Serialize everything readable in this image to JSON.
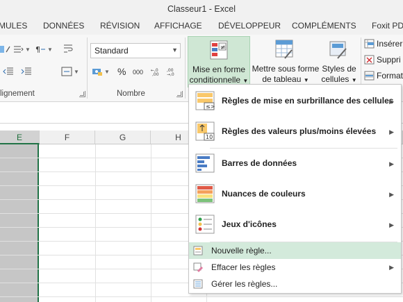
{
  "window": {
    "title": "Classeur1 - Excel"
  },
  "tabs": [
    "MULES",
    "DONNÉES",
    "RÉVISION",
    "AFFICHAGE",
    "DÉVELOPPEUR",
    "COMPLÉMENTS",
    "Foxit PDF"
  ],
  "ribbon": {
    "alignment_label": "lignement",
    "number_label": "Nombre",
    "number_format_value": "Standard",
    "percent_symbol": "%",
    "thousands_symbol": "000",
    "cond_format_line1": "Mise en forme",
    "cond_format_line2": "conditionnelle",
    "table_format_line1": "Mettre sous forme",
    "table_format_line2": "de tableau",
    "cell_styles_line1": "Styles de",
    "cell_styles_line2": "cellules",
    "cells_insert": "Insérer",
    "cells_delete": "Suppri",
    "cells_format": "Format"
  },
  "columns": [
    "E",
    "F",
    "G",
    "H"
  ],
  "menu": {
    "items": [
      {
        "label": "Règles de mise en surbrillance des cellules",
        "icon": "highlight-rules-icon"
      },
      {
        "label": "Règles des valeurs plus/moins élevées",
        "icon": "top-bottom-rules-icon"
      },
      {
        "label": "Barres de données",
        "icon": "data-bars-icon"
      },
      {
        "label": "Nuances de couleurs",
        "icon": "color-scales-icon"
      },
      {
        "label": "Jeux d'icônes",
        "icon": "icon-sets-icon"
      }
    ],
    "new_rule": "Nouvelle règle...",
    "clear_rules": "Effacer les règles",
    "manage_rules": "Gérer les règles..."
  },
  "colors": {
    "excel_green": "#217346",
    "highlight": "#d3eadb"
  }
}
